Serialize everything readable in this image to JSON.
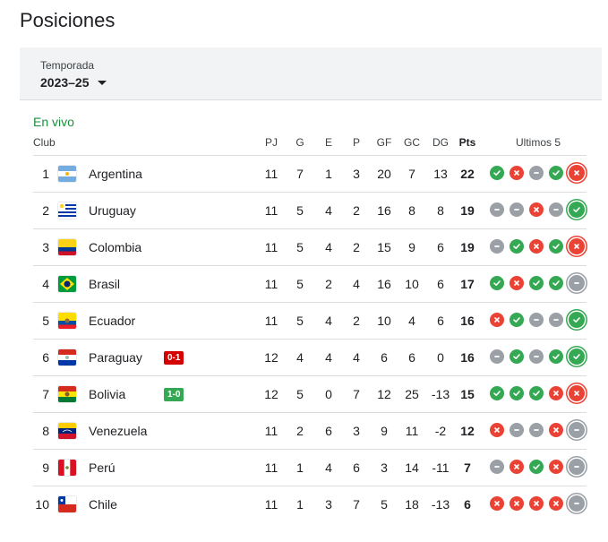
{
  "title": "Posiciones",
  "filter": {
    "label": "Temporada",
    "value": "2023–25"
  },
  "live_label": "En vivo",
  "columns": {
    "club": "Club",
    "pj": "PJ",
    "g": "G",
    "e": "E",
    "p": "P",
    "gf": "GF",
    "gc": "GC",
    "dg": "DG",
    "pts": "Pts",
    "last5": "Ultimos 5"
  },
  "colors": {
    "win": "#34a853",
    "loss": "#ea4335",
    "draw": "#9aa0a6",
    "live_loss": "#d50000",
    "live_win": "#34a853",
    "accent": "#1e8e3e"
  },
  "rows": [
    {
      "pos": "1",
      "club": "Argentina",
      "flag": "argentina",
      "pj": "11",
      "g": "7",
      "e": "1",
      "p": "3",
      "gf": "20",
      "gc": "7",
      "dg": "13",
      "pts": "22",
      "form": [
        "W",
        "L",
        "D",
        "W",
        "L"
      ]
    },
    {
      "pos": "2",
      "club": "Uruguay",
      "flag": "uruguay",
      "pj": "11",
      "g": "5",
      "e": "4",
      "p": "2",
      "gf": "16",
      "gc": "8",
      "dg": "8",
      "pts": "19",
      "form": [
        "D",
        "D",
        "L",
        "D",
        "W"
      ]
    },
    {
      "pos": "3",
      "club": "Colombia",
      "flag": "colombia",
      "pj": "11",
      "g": "5",
      "e": "4",
      "p": "2",
      "gf": "15",
      "gc": "9",
      "dg": "6",
      "pts": "19",
      "form": [
        "D",
        "W",
        "L",
        "W",
        "L"
      ]
    },
    {
      "pos": "4",
      "club": "Brasil",
      "flag": "brasil",
      "pj": "11",
      "g": "5",
      "e": "2",
      "p": "4",
      "gf": "16",
      "gc": "10",
      "dg": "6",
      "pts": "17",
      "form": [
        "W",
        "L",
        "W",
        "W",
        "D"
      ]
    },
    {
      "pos": "5",
      "club": "Ecuador",
      "flag": "ecuador",
      "pj": "11",
      "g": "5",
      "e": "4",
      "p": "2",
      "gf": "10",
      "gc": "4",
      "dg": "6",
      "pts": "16",
      "form": [
        "L",
        "W",
        "D",
        "D",
        "W"
      ]
    },
    {
      "pos": "6",
      "club": "Paraguay",
      "flag": "paraguay",
      "live": "0-1",
      "live_result": "loss",
      "pj": "12",
      "g": "4",
      "e": "4",
      "p": "4",
      "gf": "6",
      "gc": "6",
      "dg": "0",
      "pts": "16",
      "form": [
        "D",
        "W",
        "D",
        "W",
        "W"
      ]
    },
    {
      "pos": "7",
      "club": "Bolivia",
      "flag": "bolivia",
      "live": "1-0",
      "live_result": "win",
      "pj": "12",
      "g": "5",
      "e": "0",
      "p": "7",
      "gf": "12",
      "gc": "25",
      "dg": "-13",
      "pts": "15",
      "form": [
        "W",
        "W",
        "W",
        "L",
        "L"
      ]
    },
    {
      "pos": "8",
      "club": "Venezuela",
      "flag": "venezuela",
      "pj": "11",
      "g": "2",
      "e": "6",
      "p": "3",
      "gf": "9",
      "gc": "11",
      "dg": "-2",
      "pts": "12",
      "form": [
        "L",
        "D",
        "D",
        "L",
        "D"
      ]
    },
    {
      "pos": "9",
      "club": "Perú",
      "flag": "peru",
      "pj": "11",
      "g": "1",
      "e": "4",
      "p": "6",
      "gf": "3",
      "gc": "14",
      "dg": "-11",
      "pts": "7",
      "form": [
        "D",
        "L",
        "W",
        "L",
        "D"
      ]
    },
    {
      "pos": "10",
      "club": "Chile",
      "flag": "chile",
      "pj": "11",
      "g": "1",
      "e": "3",
      "p": "7",
      "gf": "5",
      "gc": "18",
      "dg": "-13",
      "pts": "6",
      "form": [
        "L",
        "L",
        "L",
        "L",
        "D"
      ]
    }
  ]
}
